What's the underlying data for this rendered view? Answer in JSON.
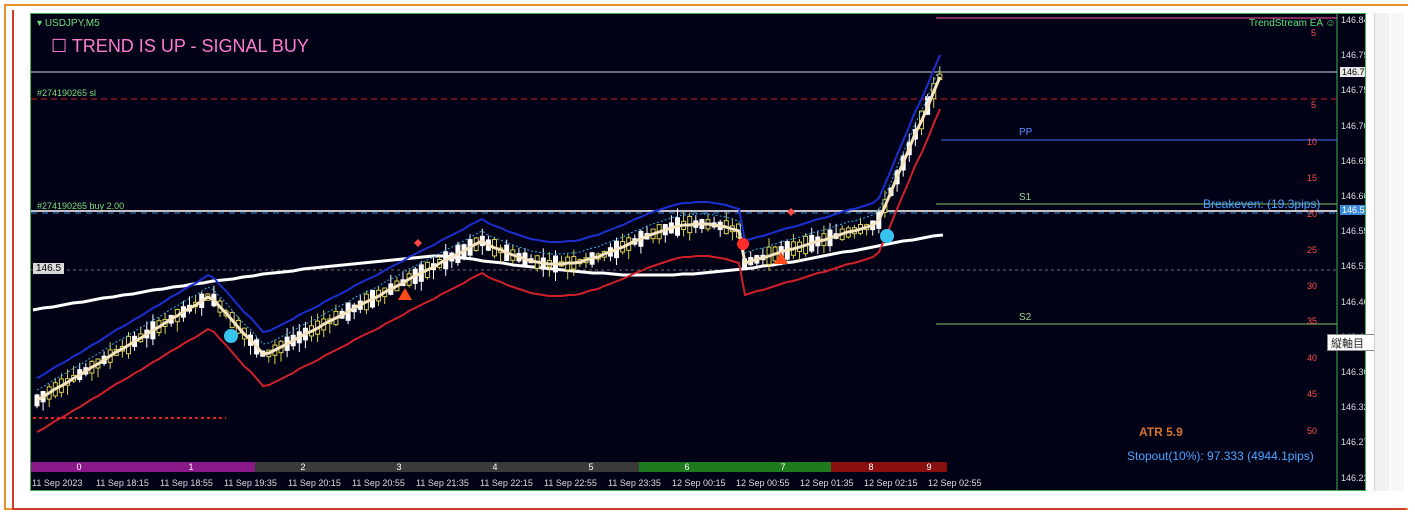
{
  "chart": {
    "symbol": "USDJPY,M5",
    "signal_text": "☐ TREND IS UP - SIGNAL BUY",
    "ea_name": "TrendStream EA ☺",
    "order_sl_label": "#274190265 sl",
    "order_buy_label": "#274190265 buy 2.00",
    "price_marker_label": "146.5",
    "pivot_labels": {
      "pp": "PP",
      "s1": "S1",
      "s2": "S2"
    },
    "breakeven_text": "Breakeven: (19.3pips)",
    "atr_text": "ATR 5.9",
    "stopout_text": "Stopout(10%): 97.333 (4944.1pips)",
    "popup_text": "縦軸目盛",
    "price_axis": [
      "146.845",
      "146.795",
      "146.750",
      "146.700",
      "146.655",
      "146.605",
      "146.555",
      "146.510",
      "146.460",
      "146.415",
      "146.365",
      "146.320",
      "146.270",
      "146.225"
    ],
    "price_tags": {
      "current": "146.772",
      "buy": "146.581"
    },
    "pip_axis": [
      "5",
      "5",
      "10",
      "15",
      "20",
      "25",
      "30",
      "35",
      "40",
      "45",
      "50"
    ],
    "time_labels": [
      "11 Sep 2023",
      "11 Sep 18:15",
      "11 Sep 18:55",
      "11 Sep 19:35",
      "11 Sep 20:15",
      "11 Sep 20:55",
      "11 Sep 21:35",
      "11 Sep 22:15",
      "11 Sep 22:55",
      "11 Sep 23:35",
      "12 Sep 00:15",
      "12 Sep 00:55",
      "12 Sep 01:35",
      "12 Sep 02:15",
      "12 Sep 02:55"
    ],
    "session_segments": [
      {
        "label": "0",
        "color": "#8a1a8a"
      },
      {
        "label": "1",
        "color": "#8a1a8a"
      },
      {
        "label": "2",
        "color": "#3a3a3a"
      },
      {
        "label": "3",
        "color": "#3a3a3a"
      },
      {
        "label": "4",
        "color": "#3a3a3a"
      },
      {
        "label": "5",
        "color": "#3a3a3a"
      },
      {
        "label": "6",
        "color": "#1f7a1f"
      },
      {
        "label": "7",
        "color": "#1f7a1f"
      },
      {
        "label": "8",
        "color": "#8a1010"
      },
      {
        "label": "9",
        "color": "#8a1010"
      }
    ],
    "colors": {
      "background": "#020217",
      "bull_candle": "#ffffff",
      "bear_candle": "#d8d04a",
      "upper_band": "#1a2fd0",
      "lower_band": "#d0202a",
      "baseline": "#f4e4c0",
      "envelope": "#ffffff",
      "signal_dot": "#38c4f0",
      "arrow": "#ff4a1a"
    }
  }
}
